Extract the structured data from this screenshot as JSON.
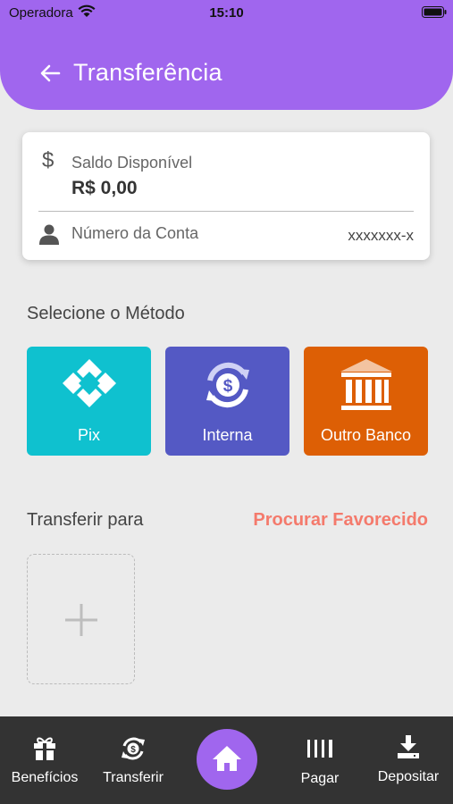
{
  "status_bar": {
    "carrier": "Operadora",
    "time": "15:10"
  },
  "header": {
    "title": "Transferência",
    "back_icon": "arrow-left-icon",
    "color": "#a066ee"
  },
  "balance": {
    "label": "Saldo Disponível",
    "value": "R$ 0,00",
    "account_label": "Número da Conta",
    "account_value": "xxxxxxx-x"
  },
  "methods": {
    "title": "Selecione o Método",
    "items": [
      {
        "label": "Pix",
        "icon": "pix-icon",
        "color": "#0fc1cf"
      },
      {
        "label": "Interna",
        "icon": "dollar-exchange-icon",
        "color": "#5459c4"
      },
      {
        "label": "Outro Banco",
        "icon": "bank-icon",
        "color": "#dd5f05"
      }
    ]
  },
  "transfer_to": {
    "title": "Transferir para",
    "search_link": "Procurar Favorecido",
    "add_icon": "plus-icon"
  },
  "bottom_nav": {
    "items": [
      {
        "label": "Benefícios",
        "icon": "gift-icon"
      },
      {
        "label": "Transferir",
        "icon": "transfer-icon"
      },
      {
        "label": "",
        "icon": "home-icon"
      },
      {
        "label": "Pagar",
        "icon": "barcode-icon"
      },
      {
        "label": "Depositar",
        "icon": "download-icon"
      }
    ]
  }
}
